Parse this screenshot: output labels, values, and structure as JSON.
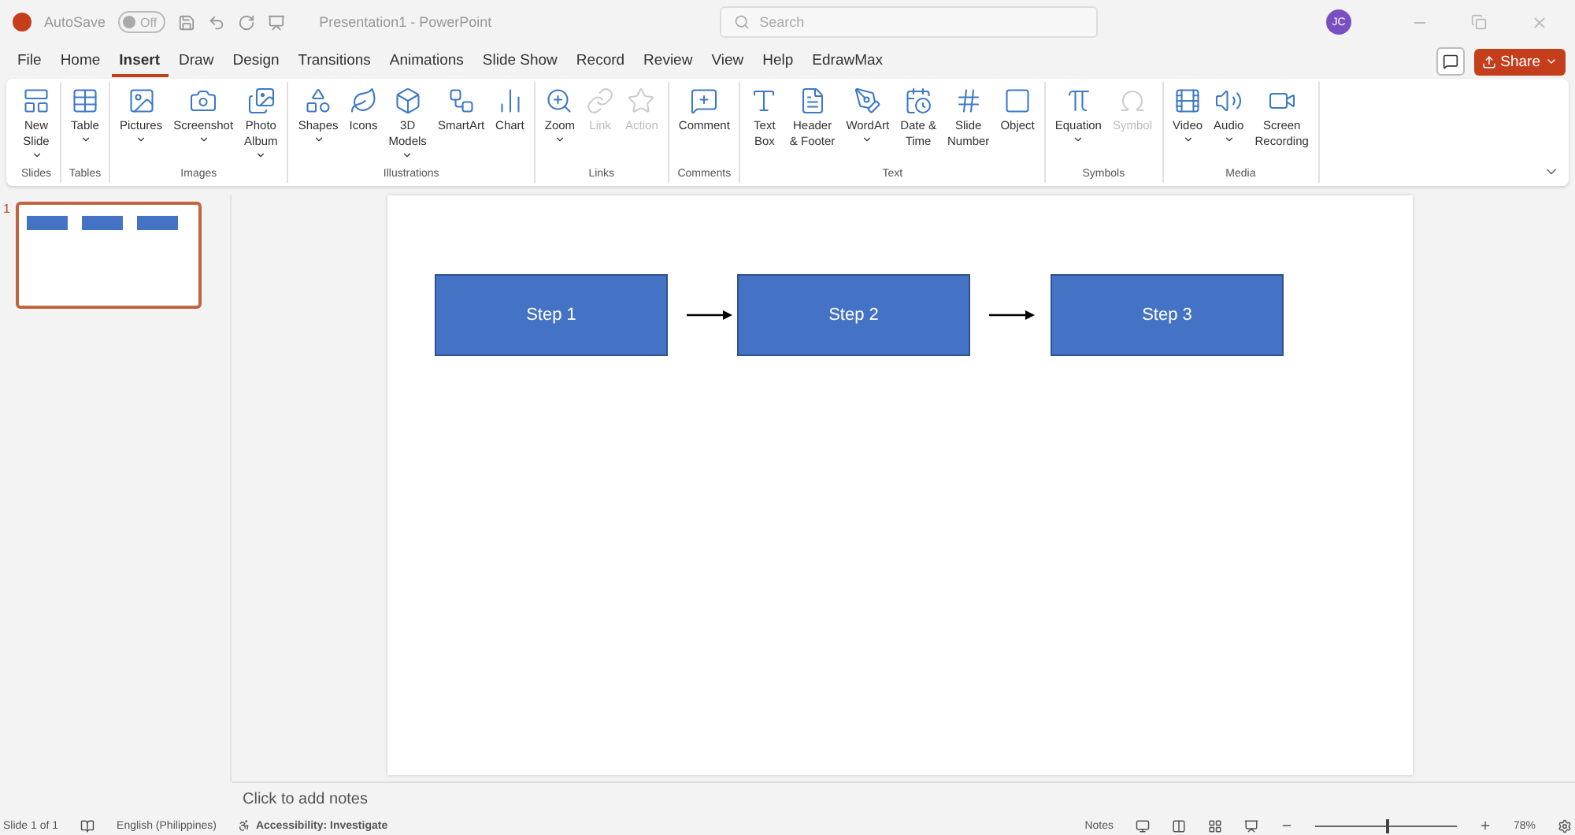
{
  "title_bar": {
    "autosave_label": "AutoSave",
    "autosave_state": "Off",
    "autosave_on": false,
    "title": "Presentation1  -  PowerPoint",
    "search": {
      "placeholder": "Search"
    },
    "avatar": "JC"
  },
  "tabs": [
    {
      "label": "File",
      "selected": false
    },
    {
      "label": "Home",
      "selected": false
    },
    {
      "label": "Insert",
      "selected": true
    },
    {
      "label": "Draw",
      "selected": false
    },
    {
      "label": "Design",
      "selected": false
    },
    {
      "label": "Transitions",
      "selected": false
    },
    {
      "label": "Animations",
      "selected": false
    },
    {
      "label": "Slide Show",
      "selected": false
    },
    {
      "label": "Record",
      "selected": false
    },
    {
      "label": "Review",
      "selected": false
    },
    {
      "label": "View",
      "selected": false
    },
    {
      "label": "Help",
      "selected": false
    },
    {
      "label": "EdrawMax",
      "selected": false
    }
  ],
  "share_button": "Share",
  "ribbon": [
    {
      "name": "Slides",
      "buttons": [
        {
          "kind": "slide",
          "lines": [
            "New",
            "Slide"
          ],
          "dropdown": true,
          "disabled": false
        }
      ]
    },
    {
      "name": "Tables",
      "buttons": [
        {
          "kind": "table",
          "lines": [
            "Table"
          ],
          "dropdown": true,
          "disabled": false
        }
      ]
    },
    {
      "name": "Images",
      "buttons": [
        {
          "kind": "pictures",
          "lines": [
            "Pictures"
          ],
          "dropdown": true,
          "disabled": false
        },
        {
          "kind": "screenshot",
          "lines": [
            "Screenshot"
          ],
          "dropdown": true,
          "disabled": false
        },
        {
          "kind": "album",
          "lines": [
            "Photo",
            "Album"
          ],
          "dropdown": true,
          "disabled": false
        }
      ]
    },
    {
      "name": "Illustrations",
      "buttons": [
        {
          "kind": "shapes",
          "lines": [
            "Shapes"
          ],
          "dropdown": true,
          "disabled": false
        },
        {
          "kind": "icons",
          "lines": [
            "Icons"
          ],
          "dropdown": false,
          "disabled": false
        },
        {
          "kind": "cube",
          "lines": [
            "3D",
            "Models"
          ],
          "dropdown": true,
          "disabled": false
        },
        {
          "kind": "smartart",
          "lines": [
            "SmartArt"
          ],
          "dropdown": false,
          "disabled": false
        },
        {
          "kind": "chart",
          "lines": [
            "Chart"
          ],
          "dropdown": false,
          "disabled": false
        }
      ]
    },
    {
      "name": "Links",
      "buttons": [
        {
          "kind": "zoom",
          "lines": [
            "Zoom"
          ],
          "dropdown": true,
          "disabled": false
        },
        {
          "kind": "link",
          "lines": [
            "Link"
          ],
          "dropdown": false,
          "disabled": true
        },
        {
          "kind": "action",
          "lines": [
            "Action"
          ],
          "dropdown": false,
          "disabled": true
        }
      ]
    },
    {
      "name": "Comments",
      "buttons": [
        {
          "kind": "comment",
          "lines": [
            "Comment"
          ],
          "dropdown": false,
          "disabled": false
        }
      ]
    },
    {
      "name": "Text",
      "buttons": [
        {
          "kind": "textbox",
          "lines": [
            "Text",
            "Box"
          ],
          "dropdown": false,
          "disabled": false
        },
        {
          "kind": "header",
          "lines": [
            "Header",
            "& Footer"
          ],
          "dropdown": false,
          "disabled": false
        },
        {
          "kind": "wordart",
          "lines": [
            "WordArt"
          ],
          "dropdown": true,
          "disabled": false
        },
        {
          "kind": "datetime",
          "lines": [
            "Date &",
            "Time"
          ],
          "dropdown": false,
          "disabled": false
        },
        {
          "kind": "number",
          "lines": [
            "Slide",
            "Number"
          ],
          "dropdown": false,
          "disabled": false
        },
        {
          "kind": "object",
          "lines": [
            "Object"
          ],
          "dropdown": false,
          "disabled": false
        }
      ]
    },
    {
      "name": "Symbols",
      "buttons": [
        {
          "kind": "equation",
          "lines": [
            "Equation"
          ],
          "dropdown": true,
          "disabled": false
        },
        {
          "kind": "symbol",
          "lines": [
            "Symbol"
          ],
          "dropdown": false,
          "disabled": true
        }
      ]
    },
    {
      "name": "Media",
      "buttons": [
        {
          "kind": "video",
          "lines": [
            "Video"
          ],
          "dropdown": true,
          "disabled": false
        },
        {
          "kind": "audio",
          "lines": [
            "Audio"
          ],
          "dropdown": true,
          "disabled": false
        },
        {
          "kind": "recording",
          "lines": [
            "Screen",
            "Recording"
          ],
          "dropdown": false,
          "disabled": false
        }
      ]
    }
  ],
  "thumbnails": [
    {
      "number": "1",
      "selected": true
    }
  ],
  "slide": {
    "steps": [
      "Step 1",
      "Step 2",
      "Step 3"
    ]
  },
  "notes_placeholder": "Click to add notes",
  "status_bar": {
    "slide_count": "Slide 1 of 1",
    "language": "English (Philippines)",
    "accessibility": "Accessibility: Investigate",
    "notes": "Notes",
    "zoom": {
      "level": 0.5,
      "reading": "78%"
    }
  }
}
